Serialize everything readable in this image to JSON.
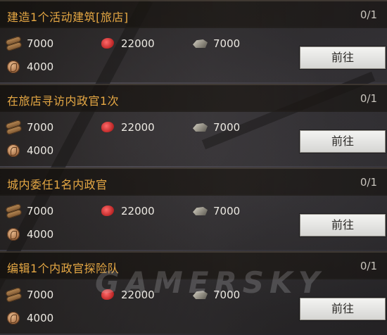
{
  "quests": [
    {
      "title": "建造1个活动建筑[旅店]",
      "progress": "0/1",
      "resources": {
        "wood": "7000",
        "meat": "22000",
        "stone": "7000",
        "coin": "4000"
      },
      "button_label": "前往"
    },
    {
      "title": "在旅店寻访内政官1次",
      "progress": "0/1",
      "resources": {
        "wood": "7000",
        "meat": "22000",
        "stone": "7000",
        "coin": "4000"
      },
      "button_label": "前往"
    },
    {
      "title": "城内委任1名内政官",
      "progress": "0/1",
      "resources": {
        "wood": "7000",
        "meat": "22000",
        "stone": "7000",
        "coin": "4000"
      },
      "button_label": "前往"
    },
    {
      "title": "编辑1个内政官探险队",
      "progress": "0/1",
      "resources": {
        "wood": "7000",
        "meat": "22000",
        "stone": "7000",
        "coin": "4000"
      },
      "button_label": "前往"
    }
  ],
  "watermark": "GAMERSKY",
  "colors": {
    "title": "#e6a844",
    "button_bg": "#ecebe8",
    "text": "#ece9e2"
  }
}
